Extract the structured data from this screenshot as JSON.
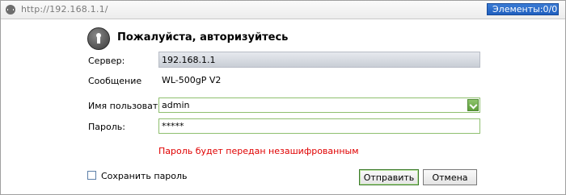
{
  "address_bar": {
    "url": "http://192.168.1.1/",
    "elements_label": "Элементы:",
    "elements_count": "0/0"
  },
  "dialog": {
    "title": "Пожалуйста, авторизуйтесь",
    "server_label": "Сервер:",
    "server_value": "192.168.1.1",
    "message_label": "Сообщение",
    "message_value": "WL-500gP V2",
    "username_label": "Имя пользователя:",
    "username_value": "admin",
    "password_label": "Пароль:",
    "password_value": "*****",
    "warning": "Пароль будет передан незашифрованным",
    "save_password_label": "Сохранить пароль",
    "save_password_checked": false,
    "submit_label": "Отправить",
    "cancel_label": "Отмена"
  },
  "colors": {
    "warning": "#e00000",
    "elements_button": "#2a6ccc",
    "input_border": "#8fbf6f"
  }
}
